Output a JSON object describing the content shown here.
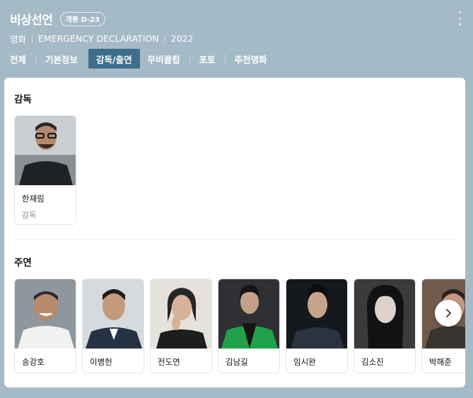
{
  "header": {
    "title": "비상선언",
    "dday_badge": "개봉 D-23",
    "meta": [
      "영화",
      "EMERGENCY DECLARATION",
      "2022"
    ],
    "more_icon": "more-vertical-icon"
  },
  "tabs": [
    {
      "label": "전체",
      "active": false
    },
    {
      "label": "기본정보",
      "active": false
    },
    {
      "label": "감독/출연",
      "active": true
    },
    {
      "label": "무비클립",
      "active": false
    },
    {
      "label": "포토",
      "active": false
    },
    {
      "label": "추천영화",
      "active": false
    }
  ],
  "directors": {
    "title": "감독",
    "people": [
      {
        "name": "한재림",
        "role": "감독"
      }
    ]
  },
  "cast": {
    "title": "주연",
    "people": [
      {
        "name": "송강호"
      },
      {
        "name": "이병헌"
      },
      {
        "name": "전도연"
      },
      {
        "name": "김남길"
      },
      {
        "name": "임시완"
      },
      {
        "name": "김소진"
      },
      {
        "name": "박해준"
      }
    ],
    "next_icon": "chevron-right-icon"
  },
  "colors": {
    "header_bg": "#a5bac7",
    "active_tab": "#3d6f8c"
  }
}
